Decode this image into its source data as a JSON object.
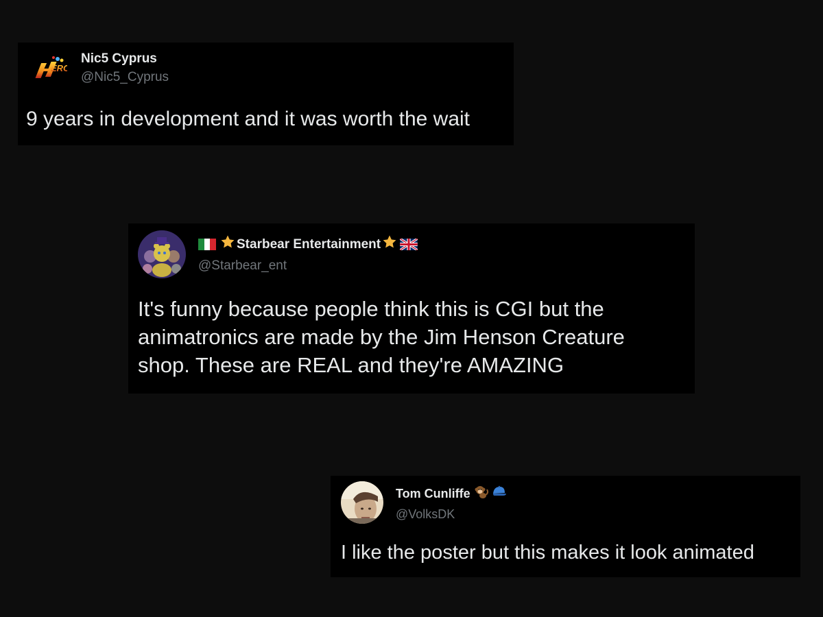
{
  "tweets": [
    {
      "display_name": "Nic5 Cyprus",
      "handle": "@Nic5_Cyprus",
      "text": "9 years in development and it was worth the wait",
      "avatar": "hero-logo-icon"
    },
    {
      "display_name": "Starbear Entertainment",
      "handle": "@Starbear_ent",
      "text": "It's funny because people think this is CGI but the\nanimatronics are made by the Jim Henson Creature\nshop. These are REAL and they're AMAZING",
      "avatar": "animatronic-bears-avatar",
      "name_prefix_icons": [
        "italy-flag-icon",
        "star-icon"
      ],
      "name_suffix_icons": [
        "star-icon",
        "uk-flag-icon"
      ]
    },
    {
      "display_name": "Tom Cunliffe",
      "handle": "@VolksDK",
      "text": "I like the poster but this makes it look animated",
      "avatar": "person-photo-avatar",
      "name_suffix_icons": [
        "monkey-icon",
        "cap-icon"
      ]
    }
  ],
  "colors": {
    "background": "#0d0d0d",
    "card": "#000000",
    "name": "#e7e9ea",
    "handle": "#71767b",
    "star": "#f4b63f"
  }
}
